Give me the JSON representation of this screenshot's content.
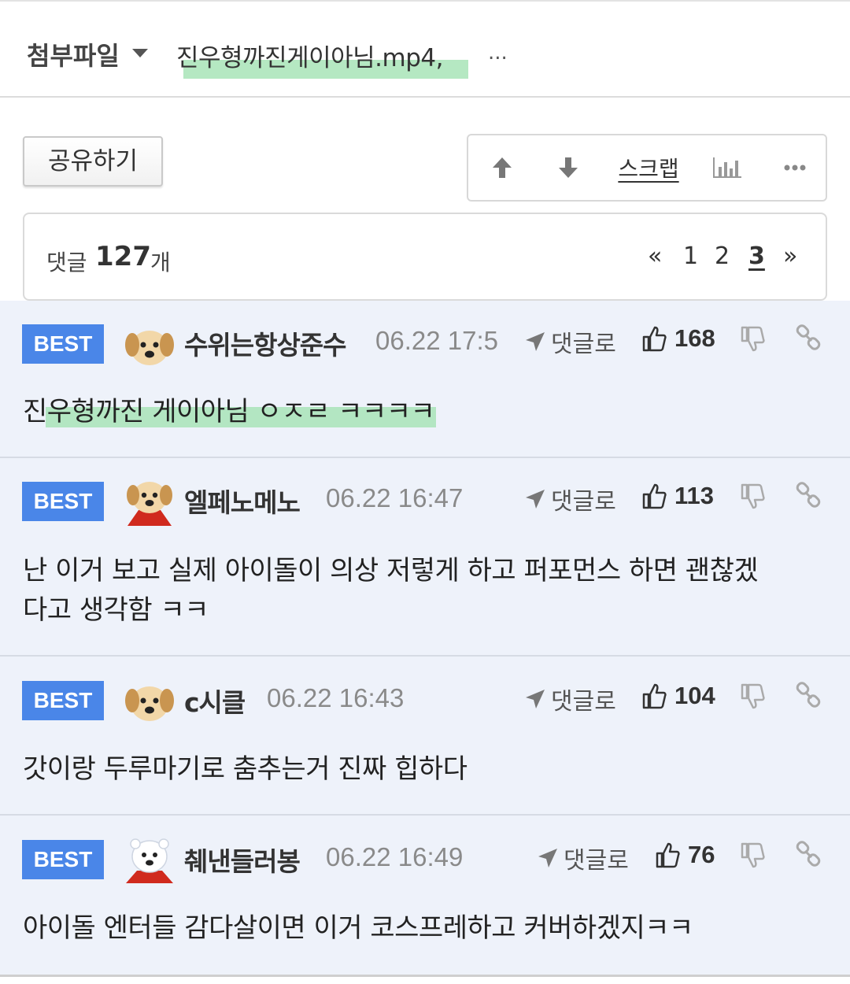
{
  "attachment": {
    "label": "첨부파일",
    "file_name": "진우형까진게이아님.mp4,",
    "more": "..."
  },
  "share_button": {
    "label": "공유하기"
  },
  "actions": {
    "upvote_icon": "arrow-up-icon",
    "downvote_icon": "arrow-down-icon",
    "scrap_label": "스크랩",
    "stats_icon": "bar-chart-icon",
    "more_icon": "more-dots-icon"
  },
  "comments_header": {
    "label": "댓글",
    "count": "127",
    "unit": "개",
    "pager": {
      "first": "«",
      "pages": [
        "1",
        "2",
        "3"
      ],
      "current": "3",
      "last": "»"
    }
  },
  "comments": [
    {
      "badge": "BEST",
      "nickname": "수위는항상준수",
      "time": "06.22 17:5",
      "reply_label": "댓글로",
      "likes": "168",
      "text": "진우형까진 게이아님 ㅇㅈㄹ ㅋㅋㅋㅋ"
    },
    {
      "badge": "BEST",
      "nickname": "엘페노메노",
      "time": "06.22 16:47",
      "reply_label": "댓글로",
      "likes": "113",
      "text_line1": "난 이거 보고 실제 아이돌이 의상 저렇게 하고 퍼포먼스 하면 괜찮겠",
      "text_line2": "다고 생각함 ㅋㅋ"
    },
    {
      "badge": "BEST",
      "nickname": "c시클",
      "time": "06.22 16:43",
      "reply_label": "댓글로",
      "likes": "104",
      "text": "갓이랑 두루마기로 춤추는거 진짜 힙하다"
    },
    {
      "badge": "BEST",
      "nickname": "췌낸들러봉",
      "time": "06.22 16:49",
      "reply_label": "댓글로",
      "likes": "76",
      "text": "아이돌 엔터들 감다살이면 이거 코스프레하고 커버하겠지ㅋㅋ"
    }
  ],
  "colors": {
    "best_badge": "#4a86e8",
    "comment_bg": "#eef2fa",
    "highlight": "#a8e4b7"
  }
}
